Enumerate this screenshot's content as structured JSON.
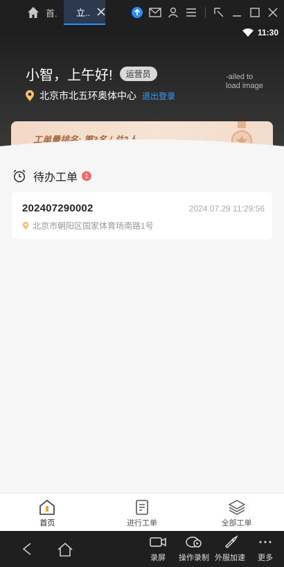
{
  "emulator": {
    "tabs": [
      {
        "label": "首."
      },
      {
        "label": "立.."
      }
    ]
  },
  "status_bar": {
    "time": "11:30"
  },
  "header": {
    "greeting": "小智，上午好!",
    "role": "运营员",
    "location": "北京市北五环奥体中心",
    "logout": "退出登录",
    "broken_image_text": "-ailed to load image"
  },
  "rank": {
    "text": "工单量排名:  第3名  /  总3人"
  },
  "todo": {
    "title": "待办工单",
    "count": "1",
    "orders": [
      {
        "id": "202407290002",
        "time": "2024.07.29 11:29:56",
        "address": "北京市朝阳区国家体育场南路1号"
      }
    ]
  },
  "tabbar": {
    "items": [
      {
        "label": "首页",
        "icon": "home-icon"
      },
      {
        "label": "进行工单",
        "icon": "document-icon"
      },
      {
        "label": "全部工单",
        "icon": "layers-icon"
      }
    ]
  },
  "emulator_bottom": {
    "actions": [
      {
        "label": "录屏",
        "icon": "video-camera-icon"
      },
      {
        "label": "操作录制",
        "icon": "record-icon"
      },
      {
        "label": "外服加速",
        "icon": "rocket-icon"
      },
      {
        "label": "更多",
        "icon": "more-icon"
      }
    ]
  },
  "colors": {
    "accent": "#3d9bff",
    "badge": "#f06b6b",
    "rank_text": "#a76b43"
  }
}
